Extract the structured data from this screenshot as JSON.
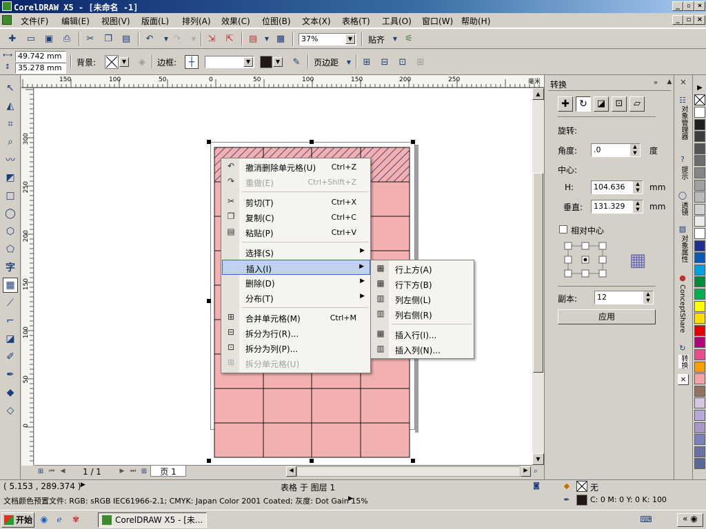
{
  "window": {
    "title": "CorelDRAW X5 - [未命名 -1]"
  },
  "menu": [
    "文件(F)",
    "编辑(E)",
    "视图(V)",
    "版面(L)",
    "排列(A)",
    "效果(C)",
    "位图(B)",
    "文本(X)",
    "表格(T)",
    "工具(O)",
    "窗口(W)",
    "帮助(H)"
  ],
  "toolbar": {
    "zoom": "37%",
    "align_label": "贴齐"
  },
  "propbar": {
    "width": "49.742 mm",
    "height": "35.278 mm",
    "background_label": "背景:",
    "border_label": "边框:",
    "margin_label": "页边距"
  },
  "ruler": {
    "h_labels": [
      "150",
      "100",
      "50",
      "0",
      "50",
      "100",
      "150",
      "200",
      "250",
      "毫米"
    ],
    "v_labels": [
      "300",
      "250",
      "200",
      "150",
      "100",
      "50",
      "0"
    ]
  },
  "context_menu": {
    "items": [
      {
        "label": "撤消删除单元格(U)",
        "shortcut": "Ctrl+Z",
        "icon": "undo-icon",
        "disabled": false
      },
      {
        "label": "重做(E)",
        "shortcut": "Ctrl+Shift+Z",
        "icon": "redo-icon",
        "disabled": true
      },
      {
        "label": "剪切(T)",
        "shortcut": "Ctrl+X",
        "icon": "scissors-icon",
        "disabled": false
      },
      {
        "label": "复制(C)",
        "shortcut": "Ctrl+C",
        "icon": "copy-icon",
        "disabled": false
      },
      {
        "label": "粘贴(P)",
        "shortcut": "Ctrl+V",
        "icon": "paste-icon",
        "disabled": false
      },
      {
        "label": "选择(S)",
        "shortcut": "",
        "icon": "",
        "disabled": false
      },
      {
        "label": "插入(I)",
        "shortcut": "",
        "icon": "",
        "disabled": false
      },
      {
        "label": "删除(D)",
        "shortcut": "",
        "icon": "",
        "disabled": false
      },
      {
        "label": "分布(T)",
        "shortcut": "",
        "icon": "",
        "disabled": false
      },
      {
        "label": "合并单元格(M)",
        "shortcut": "Ctrl+M",
        "icon": "merge-cells-icon",
        "disabled": false
      },
      {
        "label": "拆分为行(R)...",
        "shortcut": "",
        "icon": "split-rows-icon",
        "disabled": false
      },
      {
        "label": "拆分为列(P)...",
        "shortcut": "",
        "icon": "split-columns-icon",
        "disabled": false
      },
      {
        "label": "拆分单元格(U)",
        "shortcut": "",
        "icon": "split-cell-icon",
        "disabled": true
      }
    ]
  },
  "submenu": {
    "items": [
      "行上方(A)",
      "行下方(B)",
      "列左侧(L)",
      "列右侧(R)",
      "插入行(I)...",
      "插入列(N)..."
    ]
  },
  "transform_panel": {
    "title": "转换",
    "rotation_label": "旋转:",
    "angle_label": "角度:",
    "angle": ".0",
    "angle_unit": "度",
    "center_label": "中心:",
    "h_label": "H:",
    "h_value": "104.636",
    "v_label": "垂直:",
    "v_value": "131.329",
    "unit": "mm",
    "relative_center": "相对中心",
    "copies_label": "副本:",
    "copies": "12",
    "apply": "应用"
  },
  "dock_tabs": [
    "对象管理器",
    "提示",
    "透镜",
    "对象属性",
    "ConceptShare",
    "转换"
  ],
  "palette": [
    "#ffffff",
    "#1f1f1f",
    "#3c3c3c",
    "#545454",
    "#6d6d6d",
    "#868686",
    "#a0a0a0",
    "#b9b9b9",
    "#d3d3d3",
    "#ececec",
    "#ffffff",
    "#1f2f8f",
    "#0a59b5",
    "#00a0e0",
    "#008a3c",
    "#00b050",
    "#ffff00",
    "#ffde00",
    "#e00000",
    "#b4007a",
    "#e84c8c",
    "#f5a000",
    "#f0a6a8",
    "#8d7360",
    "#d8c6e0",
    "#b8a8d8",
    "#a898c8",
    "#7a80b8",
    "#6a70a8",
    "#5a6898"
  ],
  "status": {
    "coords": "( 5.153 , 289.374 )",
    "object_info": "表格 于 图层 1",
    "fill_label": "无",
    "doc_profile": "文档颜色预置文件: RGB: sRGB IEC61966-2.1; CMYK: Japan Color 2001 Coated; 灰度: Dot Gain 15%",
    "outline_info": "C: 0 M: 0 Y: 0 K: 100"
  },
  "page_nav": {
    "counter": "1 / 1",
    "tab": "页 1"
  },
  "taskbar": {
    "start": "开始",
    "task": "CorelDRAW X5 - [未..."
  }
}
